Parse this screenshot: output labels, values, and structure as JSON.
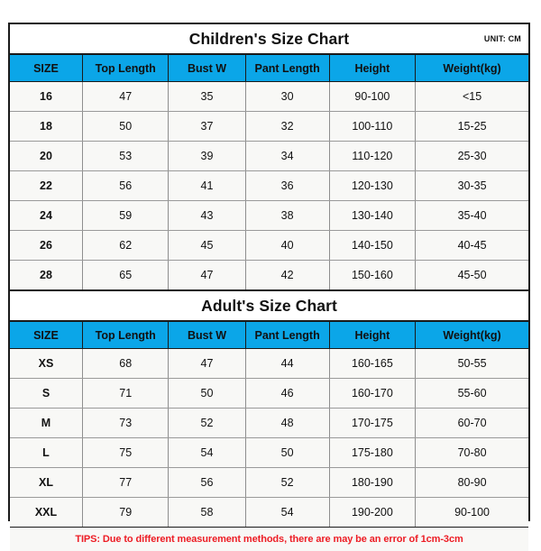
{
  "children_section": {
    "title": "Children's Size Chart",
    "unit_label": "UNIT: CM",
    "columns": [
      "SIZE",
      "Top Length",
      "Bust W",
      "Pant Length",
      "Height",
      "Weight(kg)"
    ],
    "rows": [
      [
        "16",
        "47",
        "35",
        "30",
        "90-100",
        "<15"
      ],
      [
        "18",
        "50",
        "37",
        "32",
        "100-110",
        "15-25"
      ],
      [
        "20",
        "53",
        "39",
        "34",
        "110-120",
        "25-30"
      ],
      [
        "22",
        "56",
        "41",
        "36",
        "120-130",
        "30-35"
      ],
      [
        "24",
        "59",
        "43",
        "38",
        "130-140",
        "35-40"
      ],
      [
        "26",
        "62",
        "45",
        "40",
        "140-150",
        "40-45"
      ],
      [
        "28",
        "65",
        "47",
        "42",
        "150-160",
        "45-50"
      ]
    ]
  },
  "adult_section": {
    "title": "Adult's Size Chart",
    "columns": [
      "SIZE",
      "Top Length",
      "Bust W",
      "Pant Length",
      "Height",
      "Weight(kg)"
    ],
    "rows": [
      [
        "XS",
        "68",
        "47",
        "44",
        "160-165",
        "50-55"
      ],
      [
        "S",
        "71",
        "50",
        "46",
        "160-170",
        "55-60"
      ],
      [
        "M",
        "73",
        "52",
        "48",
        "170-175",
        "60-70"
      ],
      [
        "L",
        "75",
        "54",
        "50",
        "175-180",
        "70-80"
      ],
      [
        "XL",
        "77",
        "56",
        "52",
        "180-190",
        "80-90"
      ],
      [
        "XXL",
        "79",
        "58",
        "54",
        "190-200",
        "90-100"
      ]
    ]
  },
  "tips": "TIPS: Due to different measurement methods, there are may be an error of 1cm-3cm",
  "colors": {
    "header_blue": "#0BA6E8",
    "tips_red": "#ED1C24",
    "border_dark": "#1a1a1a",
    "row_background": "#f8f8f6"
  }
}
